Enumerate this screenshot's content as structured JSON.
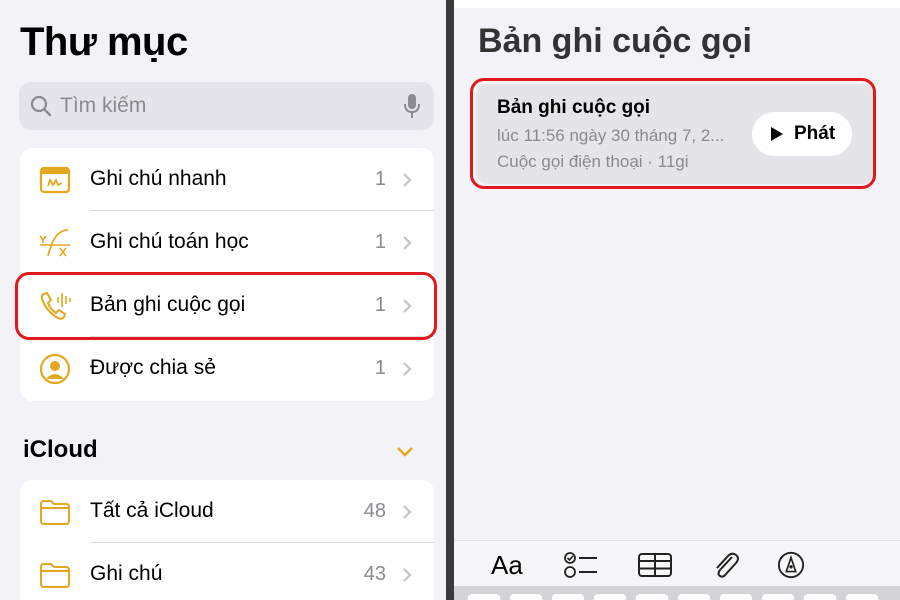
{
  "left": {
    "title": "Thư mục",
    "search_placeholder": "Tìm kiếm",
    "folders": [
      {
        "label": "Ghi chú nhanh",
        "count": "1",
        "icon": "quick-note-icon"
      },
      {
        "label": "Ghi chú toán học",
        "count": "1",
        "icon": "math-notes-icon"
      },
      {
        "label": "Bản ghi cuộc gọi",
        "count": "1",
        "icon": "call-recording-icon"
      },
      {
        "label": "Được chia sẻ",
        "count": "1",
        "icon": "shared-person-icon"
      }
    ],
    "icloud": {
      "header": "iCloud",
      "folders": [
        {
          "label": "Tất cả iCloud",
          "count": "48",
          "icon": "folder-icon"
        },
        {
          "label": "Ghi chú",
          "count": "43",
          "icon": "folder-icon"
        }
      ]
    }
  },
  "right": {
    "title": "Bản ghi cuộc gọi",
    "recording": {
      "title": "Bản ghi cuộc gọi",
      "timestamp": "lúc 11:56 ngày 30 tháng 7, 2...",
      "meta": "Cuộc gọi điện thoại · 11gi",
      "play_label": "Phát"
    }
  },
  "toolbar": {
    "format_label": "Aa",
    "items": [
      "format-text-icon",
      "checklist-icon",
      "table-icon",
      "attachment-icon",
      "markup-pen-icon"
    ]
  },
  "colors": {
    "accent": "#e3a81f",
    "highlight": "#e0191f",
    "background": "#f2f2f7",
    "secondary_text": "#8a8a8f"
  }
}
